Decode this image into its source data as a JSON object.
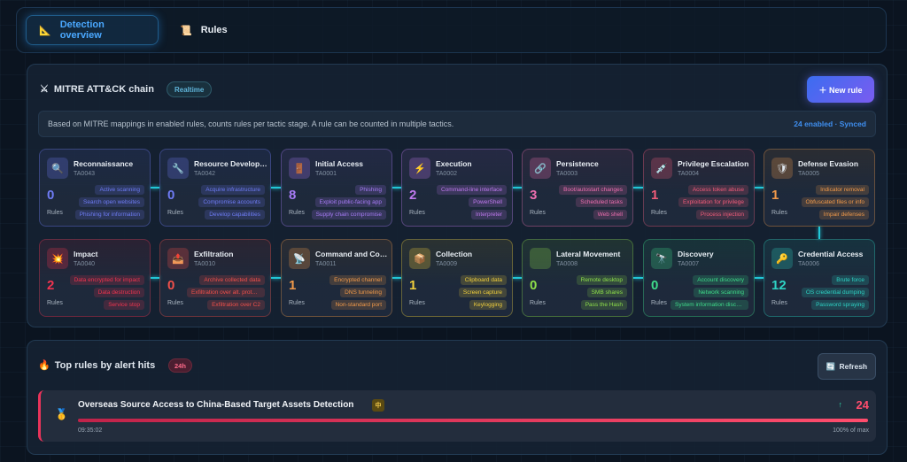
{
  "tabs": [
    {
      "label": "Detection overview",
      "icon": "chart-icon"
    },
    {
      "label": "Rules",
      "icon": "book-icon"
    }
  ],
  "chain": {
    "title": "MITRE ATT&CK chain",
    "badge": "Realtime",
    "new_rule_label": "New rule",
    "info_text": "Based on MITRE mappings in enabled rules, counts rules per tactic stage. A rule can be counted in multiple tactics.",
    "status": "24 enabled · Synced",
    "rules_label": "Rules",
    "tactics": [
      {
        "name": "Reconnaissance",
        "id": "TA0043",
        "count": "0",
        "icon": "magnifier-icon",
        "glyph": "🔍",
        "color": "#6f7cf5",
        "tags": [
          "Active scanning",
          "Search open websites",
          "Phishing for information"
        ]
      },
      {
        "name": "Resource Development",
        "id": "TA0042",
        "count": "0",
        "icon": "wrench-icon",
        "glyph": "🔧",
        "color": "#6f7cf5",
        "tags": [
          "Acquire infrastructure",
          "Compromise accounts",
          "Develop capabilities"
        ]
      },
      {
        "name": "Initial Access",
        "id": "TA0001",
        "count": "8",
        "icon": "door-icon",
        "glyph": "🚪",
        "color": "#a77bf5",
        "tags": [
          "Phishing",
          "Exploit public-facing app",
          "Supply chain compromise"
        ]
      },
      {
        "name": "Execution",
        "id": "TA0002",
        "count": "2",
        "icon": "lightning-icon",
        "glyph": "⚡",
        "color": "#c17af0",
        "tags": [
          "Command-line interface",
          "PowerShell",
          "Interpreter"
        ]
      },
      {
        "name": "Persistence",
        "id": "TA0003",
        "count": "3",
        "icon": "link-icon",
        "glyph": "🔗",
        "color": "#ef6fb0",
        "tags": [
          "Boot/autostart changes",
          "Scheduled tasks",
          "Web shell"
        ]
      },
      {
        "name": "Privilege Escalation",
        "id": "TA0004",
        "count": "1",
        "icon": "syringe-icon",
        "glyph": "💉",
        "color": "#f25c7a",
        "tags": [
          "Access token abuse",
          "Exploitation for privilege",
          "Process injection"
        ]
      },
      {
        "name": "Defense Evasion",
        "id": "TA0005",
        "count": "1",
        "icon": "shield-icon",
        "glyph": "🛡",
        "color": "#f29a4a",
        "tags": [
          "Indicator removal",
          "Obfuscated files or info",
          "Impair defenses"
        ]
      },
      {
        "name": "Impact",
        "id": "TA0040",
        "count": "2",
        "icon": "explosion-icon",
        "glyph": "💥",
        "color": "#f0344f",
        "tags": [
          "Data encrypted for impact",
          "Data destruction",
          "Service stop"
        ]
      },
      {
        "name": "Exfiltration",
        "id": "TA0010",
        "count": "0",
        "icon": "outbox-icon",
        "glyph": "📤",
        "color": "#f2504a",
        "tags": [
          "Archive collected data",
          "Exfiltration over alt. protocol",
          "Exfiltration over C2"
        ]
      },
      {
        "name": "Command and Control",
        "id": "TA0011",
        "count": "1",
        "icon": "satellite-icon",
        "glyph": "📡",
        "color": "#f29a4a",
        "tags": [
          "Encrypted channel",
          "DNS tunneling",
          "Non-standard port"
        ]
      },
      {
        "name": "Collection",
        "id": "TA0009",
        "count": "1",
        "icon": "package-icon",
        "glyph": "📦",
        "color": "#f2d03c",
        "tags": [
          "Clipboard data",
          "Screen capture",
          "Keylogging"
        ]
      },
      {
        "name": "Lateral Movement",
        "id": "TA0008",
        "count": "0",
        "icon": "arrows-icon",
        "glyph": "",
        "color": "#8fe04a",
        "tags": [
          "Remote desktop",
          "SMB shares",
          "Pass the Hash"
        ]
      },
      {
        "name": "Discovery",
        "id": "TA0007",
        "count": "0",
        "icon": "telescope-icon",
        "glyph": "🔭",
        "color": "#3fdc8a",
        "tags": [
          "Account discovery",
          "Network scanning",
          "System information discovery"
        ]
      },
      {
        "name": "Credential Access",
        "id": "TA0006",
        "count": "12",
        "icon": "key-icon",
        "glyph": "🔑",
        "color": "#2ed3c4",
        "tags": [
          "Brute force",
          "OS credential dumping",
          "Password spraying"
        ]
      }
    ]
  },
  "top_rules": {
    "title": "Top rules by alert hits",
    "badge": "24h",
    "refresh_label": "Refresh",
    "rules": [
      {
        "name": "Overseas Source Access to China-Based Target Assets Detection",
        "severity": "中",
        "time": "09:35:02",
        "count": "24",
        "pct_text": "100% of max",
        "pct": 1.0,
        "trend": "↑"
      }
    ]
  },
  "colors": {
    "accent": "#4aa8ff",
    "connector": "#22c7d8",
    "danger": "#ff4d6d"
  }
}
